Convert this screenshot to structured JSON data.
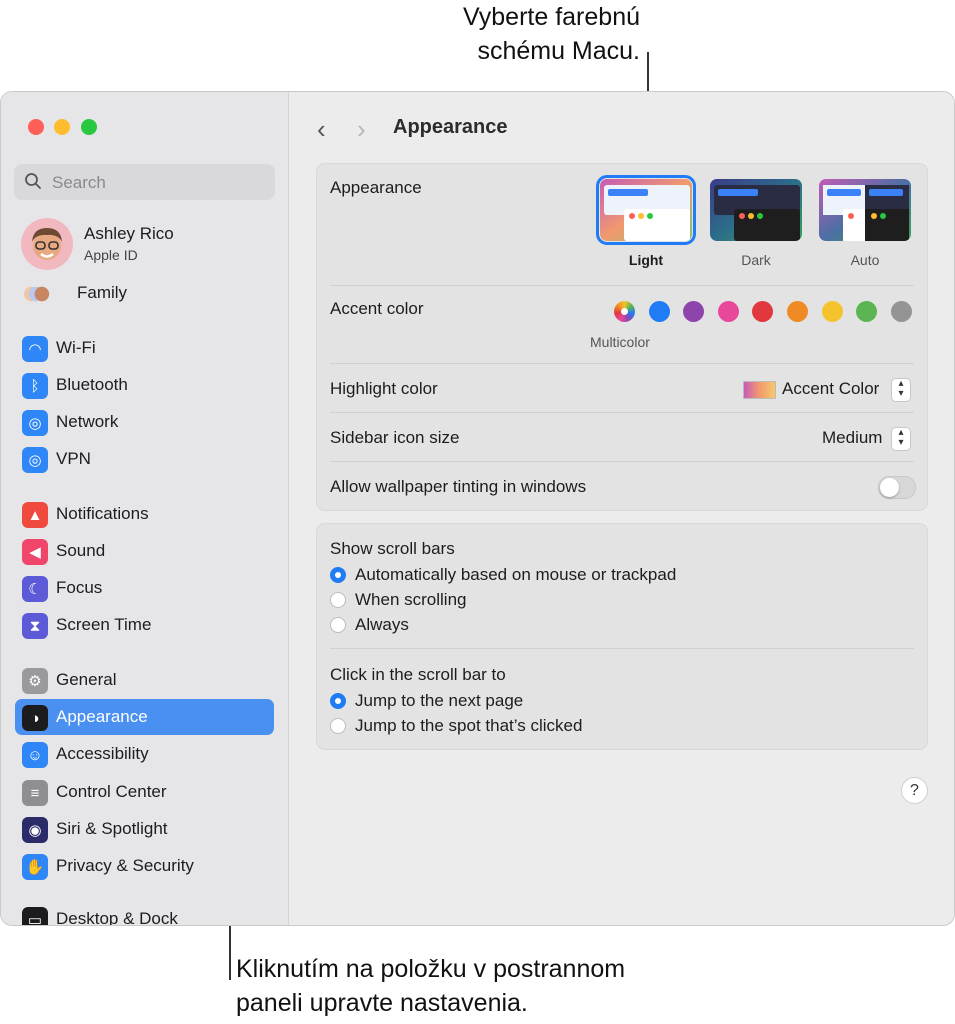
{
  "callouts": {
    "top_line1": "Vyberte farebnú",
    "top_line2": "schému Macu.",
    "bottom_line1": "Kliknutím na položku v postrannom",
    "bottom_line2": "paneli upravte nastavenia."
  },
  "sidebar": {
    "search_placeholder": "Search",
    "profile": {
      "name": "Ashley Rico",
      "subtitle": "Apple ID"
    },
    "family_label": "Family",
    "items": [
      {
        "label": "Wi-Fi",
        "icon": "wifi-icon",
        "color": "#2f86f6"
      },
      {
        "label": "Bluetooth",
        "icon": "bluetooth-icon",
        "color": "#2f86f6"
      },
      {
        "label": "Network",
        "icon": "globe-icon",
        "color": "#2f86f6"
      },
      {
        "label": "VPN",
        "icon": "vpn-globe-icon",
        "color": "#2f86f6"
      },
      {
        "label": "Notifications",
        "icon": "bell-icon",
        "color": "#f04a3e"
      },
      {
        "label": "Sound",
        "icon": "speaker-icon",
        "color": "#f0466a"
      },
      {
        "label": "Focus",
        "icon": "moon-icon",
        "color": "#5d5ad8"
      },
      {
        "label": "Screen Time",
        "icon": "hourglass-icon",
        "color": "#5d5ad8"
      },
      {
        "label": "General",
        "icon": "gear-icon",
        "color": "#9a9a9e"
      },
      {
        "label": "Appearance",
        "icon": "appearance-icon",
        "color": "#1c1c1e"
      },
      {
        "label": "Accessibility",
        "icon": "accessibility-icon",
        "color": "#2f86f6"
      },
      {
        "label": "Control Center",
        "icon": "toggles-icon",
        "color": "#8e8e93"
      },
      {
        "label": "Siri & Spotlight",
        "icon": "siri-icon",
        "color": "#2b2b6a"
      },
      {
        "label": "Privacy & Security",
        "icon": "hand-icon",
        "color": "#2f86f6"
      },
      {
        "label": "Desktop & Dock",
        "icon": "dock-icon",
        "color": "#1c1c1e"
      }
    ],
    "active_item": "Appearance"
  },
  "main": {
    "title": "Appearance",
    "appearance_label": "Appearance",
    "modes": [
      "Light",
      "Dark",
      "Auto"
    ],
    "selected_mode": "Light",
    "accent_label": "Accent color",
    "accent_caption": "Multicolor",
    "accent_colors": [
      "multicolor",
      "#1f7cf5",
      "#8e44ad",
      "#e8479a",
      "#e0383e",
      "#f08a24",
      "#f5c32c",
      "#5ab552",
      "#949494"
    ],
    "highlight_label": "Highlight color",
    "highlight_value": "Accent Color",
    "sidebar_size_label": "Sidebar icon size",
    "sidebar_size_value": "Medium",
    "tinting_label": "Allow wallpaper tinting in windows",
    "scroll_bars_label": "Show scroll bars",
    "scroll_bars_options": [
      "Automatically based on mouse or trackpad",
      "When scrolling",
      "Always"
    ],
    "click_label": "Click in the scroll bar to",
    "click_options": [
      "Jump to the next page",
      "Jump to the spot that’s clicked"
    ],
    "help": "?"
  }
}
